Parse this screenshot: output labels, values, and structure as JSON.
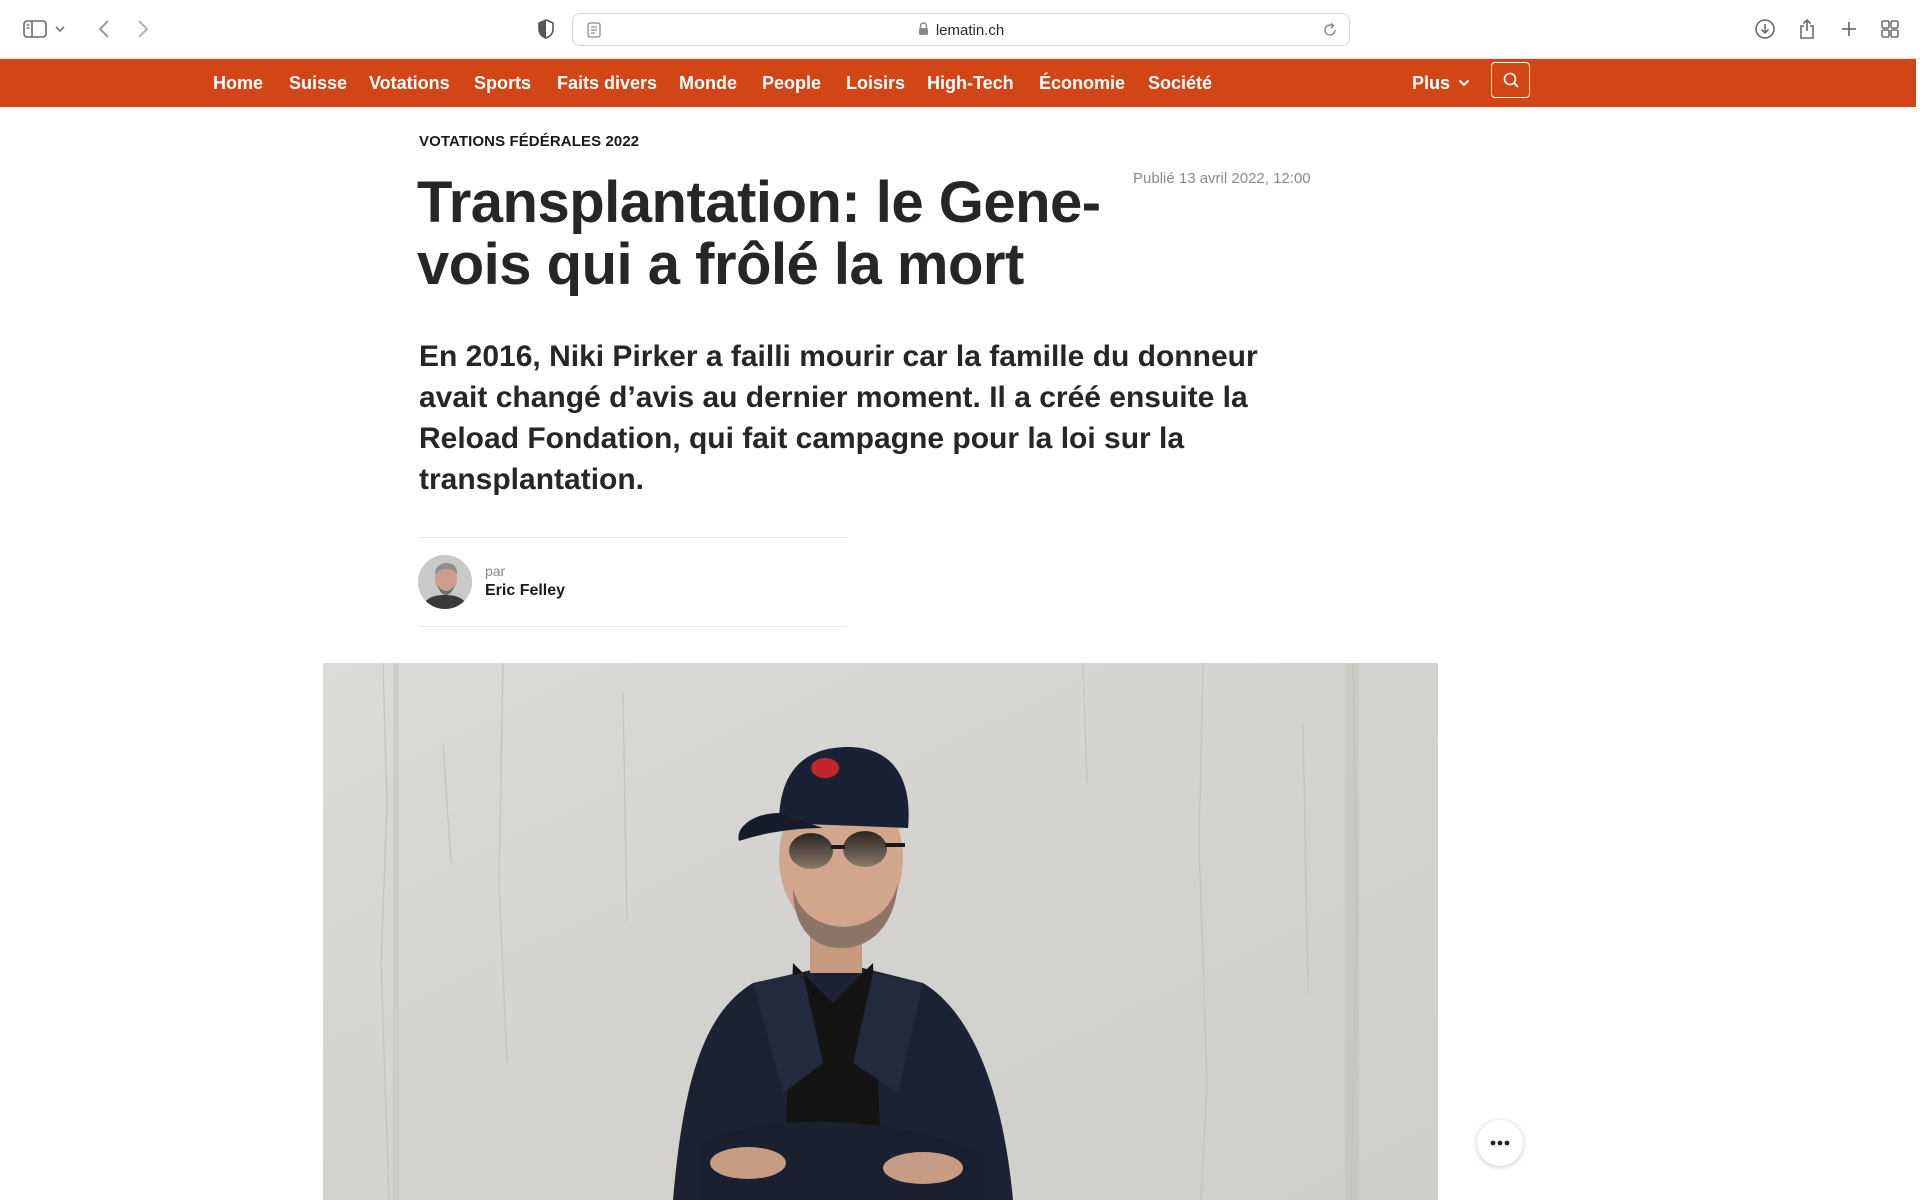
{
  "browser": {
    "url": "lematin.ch"
  },
  "nav": {
    "items": [
      {
        "label": "Home"
      },
      {
        "label": "Suisse"
      },
      {
        "label": "Votations"
      },
      {
        "label": "Sports"
      },
      {
        "label": "Faits divers"
      },
      {
        "label": "Monde"
      },
      {
        "label": "People"
      },
      {
        "label": "Loisirs"
      },
      {
        "label": "High-Tech"
      },
      {
        "label": "Économie"
      },
      {
        "label": "Société"
      }
    ],
    "more_label": "Plus",
    "brand_color": "#d14516"
  },
  "article": {
    "kicker": "Votations fédérales 2022",
    "published": "Publié 13 avril 2022, 12:00",
    "title_line1": "Transplantation: le Gene-",
    "title_line2": "vois qui a frôlé la mort",
    "lead": "En 2016, Niki Pirker a failli mourir car la famille du donneur avait changé d’avis au dernier moment. Il a créé ensuite la Reload Fondation, qui fait campagne pour la loi sur la transplantation.",
    "byline_prefix": "par",
    "author": "Eric Felley"
  },
  "icons": {
    "sidebar": "sidebar-icon",
    "back": "chevron-left-icon",
    "forward": "chevron-right-icon",
    "shield": "shield-icon",
    "reader": "reader-icon",
    "lock": "lock-icon",
    "reload": "reload-icon",
    "download": "download-icon",
    "share": "share-icon",
    "new_tab": "plus-icon",
    "tabs": "tab-overview-icon",
    "search": "search-icon",
    "more": "ellipsis-icon"
  }
}
